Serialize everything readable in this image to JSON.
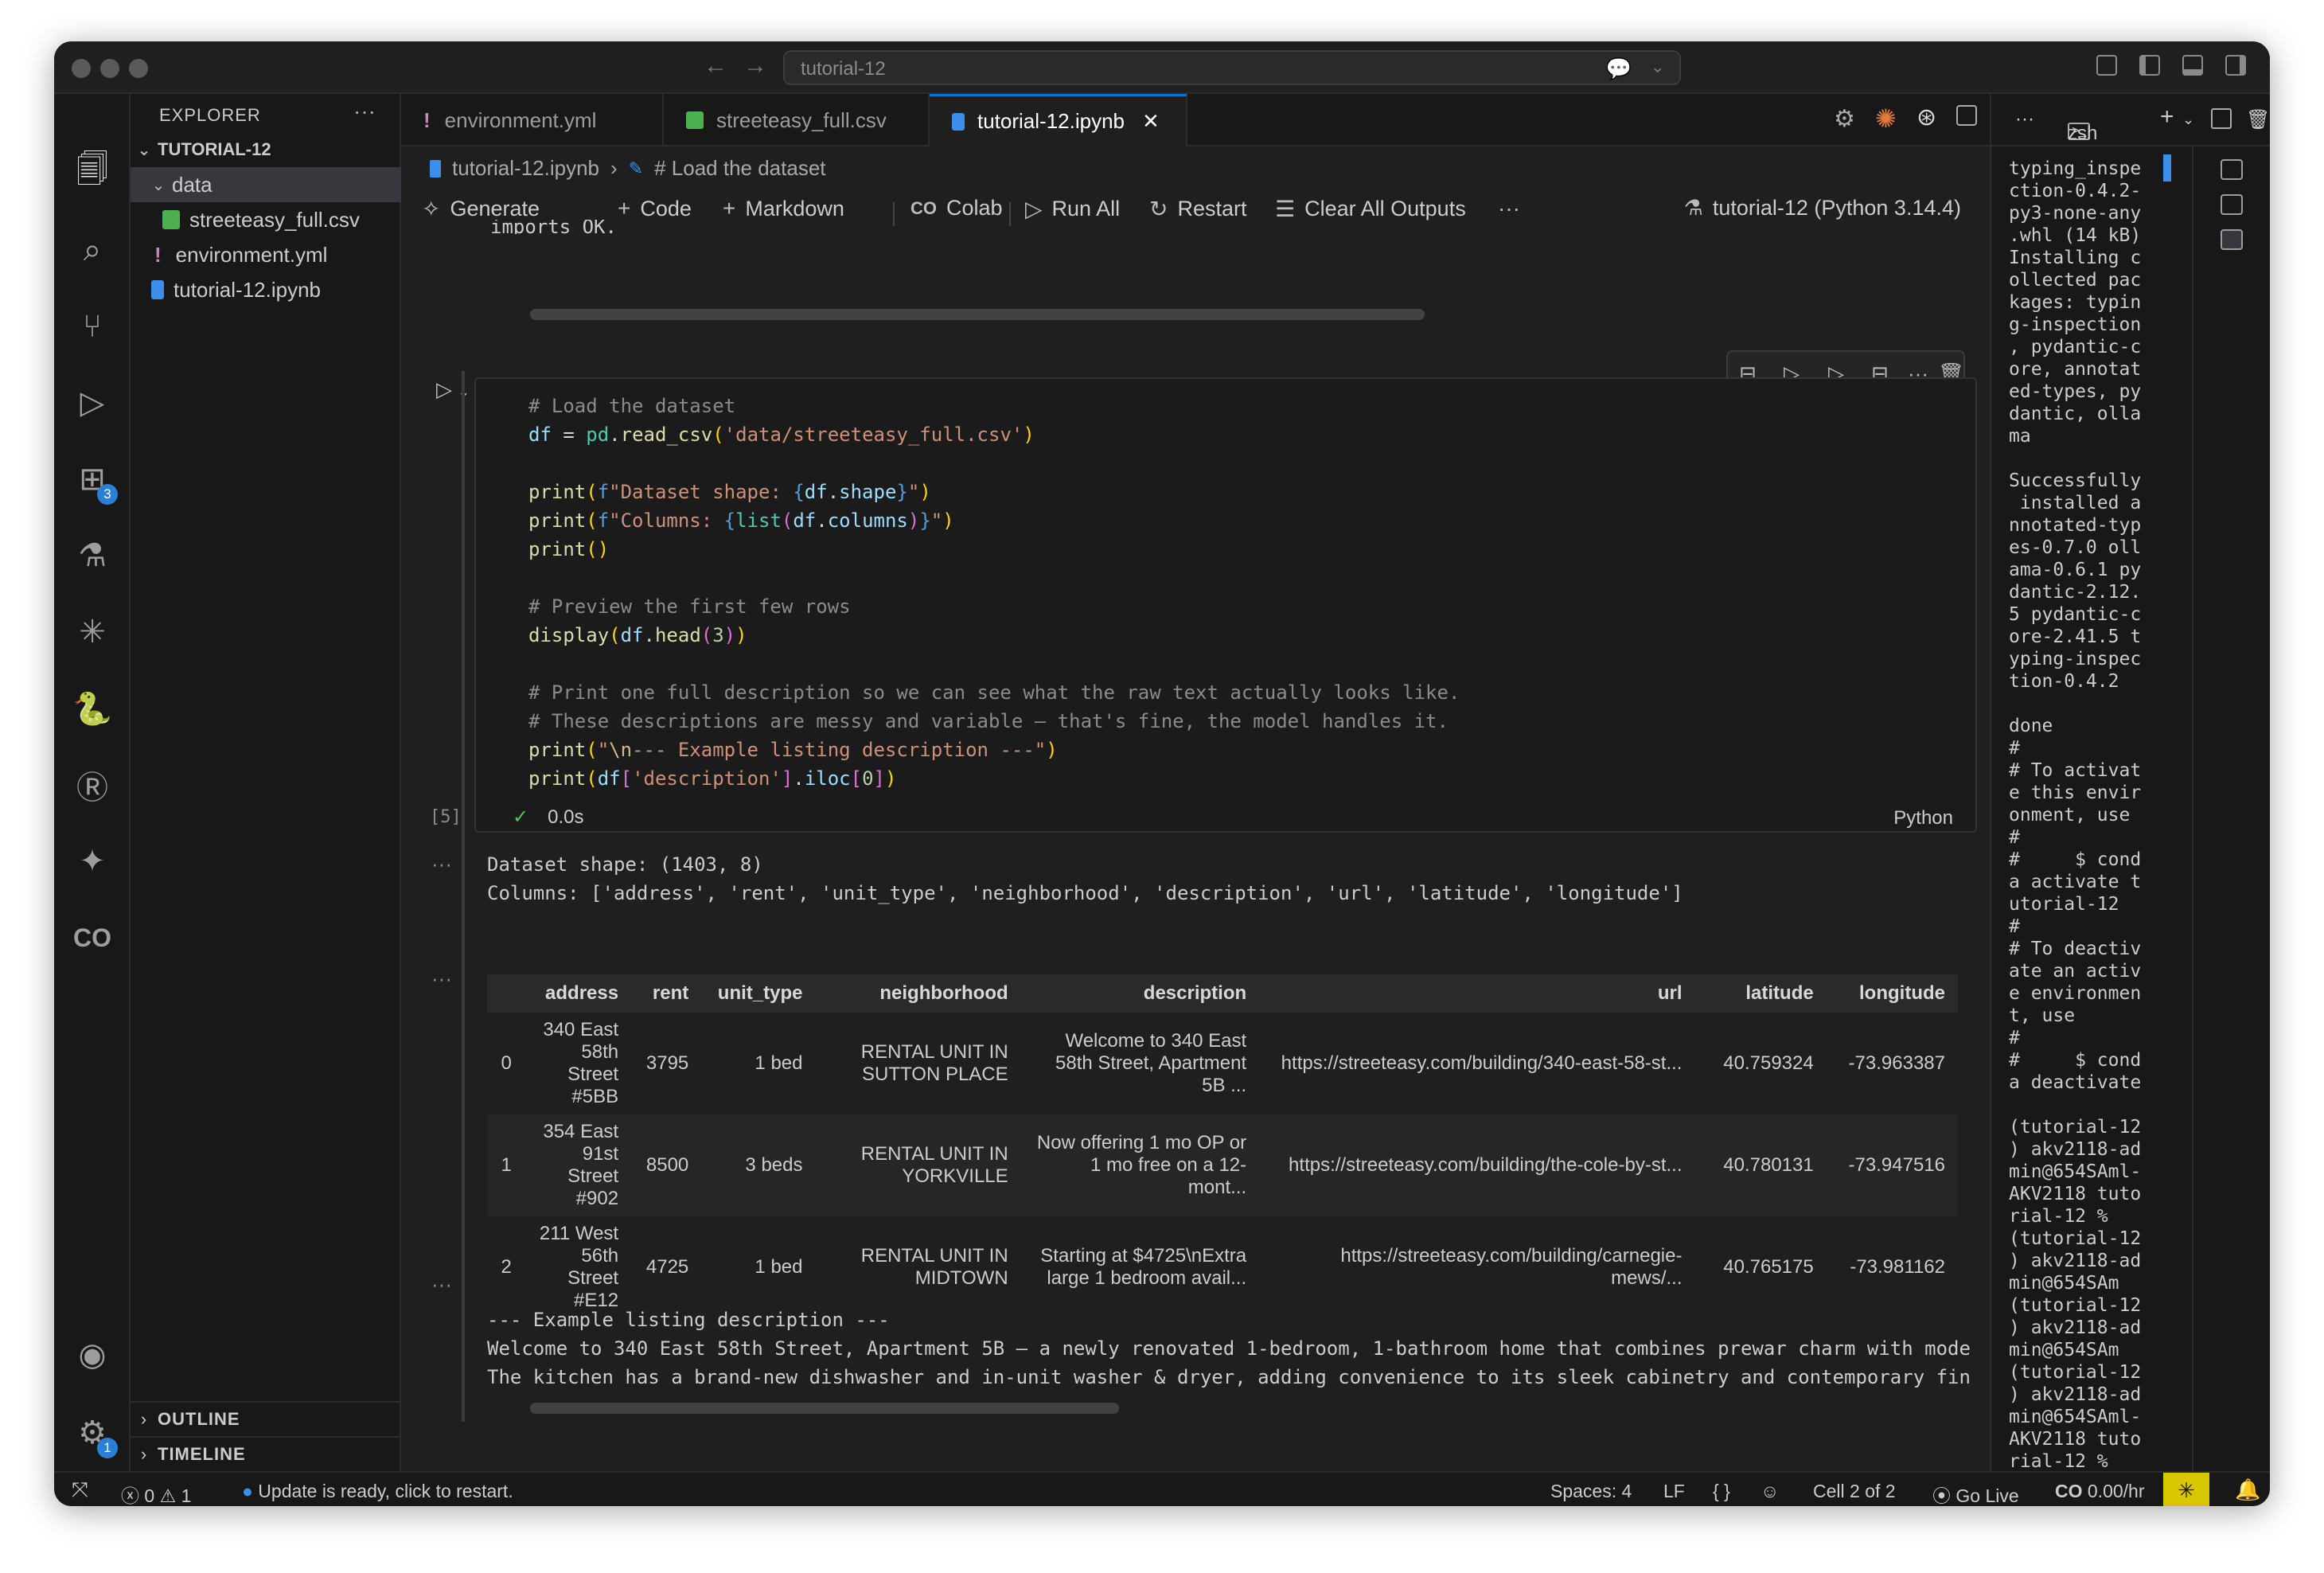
{
  "window": {
    "title": "tutorial-12"
  },
  "explorer": {
    "title": "EXPLORER",
    "project": "TUTORIAL-12",
    "tree": [
      {
        "label": "data"
      },
      {
        "label": "streeteasy_full.csv"
      },
      {
        "label": "environment.yml"
      },
      {
        "label": "tutorial-12.ipynb"
      }
    ],
    "outline": "OUTLINE",
    "timeline": "TIMELINE"
  },
  "activity": {
    "extensions_badge": "3",
    "settings_badge": "1"
  },
  "tabs": [
    {
      "label": "environment.yml"
    },
    {
      "label": "streeteasy_full.csv"
    },
    {
      "label": "tutorial-12.ipynb"
    }
  ],
  "breadcrumb": {
    "file": "tutorial-12.ipynb",
    "section": "# Load the dataset"
  },
  "toolbar": {
    "generate": "Generate",
    "code": "Code",
    "markdown": "Markdown",
    "colab": "Colab",
    "run_all": "Run All",
    "restart": "Restart",
    "clear_outputs": "Clear All Outputs",
    "kernel": "tutorial-12 (Python 3.14.4)"
  },
  "prev_output": "imports OK.",
  "cell": {
    "exec_count": "[5]",
    "time": "0.0s",
    "language": "Python"
  },
  "output": {
    "shape_line": "Dataset shape: (1403, 8)",
    "columns_line": "Columns: ['address', 'rent', 'unit_type', 'neighborhood', 'description', 'url', 'latitude', 'longitude']",
    "example_header": "--- Example listing description ---",
    "example_line1": "Welcome to 340 East 58th Street, Apartment 5B — a newly renovated 1-bedroom, 1-bathroom home that combines prewar charm with moder",
    "example_line2": "The kitchen has a brand-new dishwasher and in-unit washer & dryer, adding convenience to its sleek cabinetry and contemporary fin:"
  },
  "table": {
    "headers": [
      "",
      "address",
      "rent",
      "unit_type",
      "neighborhood",
      "description",
      "url",
      "latitude",
      "longitude"
    ],
    "rows": [
      {
        "idx": "0",
        "address": "340 East 58th Street #5BB",
        "rent": "3795",
        "unit_type": "1 bed",
        "neighborhood": "RENTAL UNIT IN SUTTON PLACE",
        "description": "Welcome to 340 East 58th Street, Apartment 5B ...",
        "url": "https://streeteasy.com/building/340-east-58-st...",
        "latitude": "40.759324",
        "longitude": "-73.963387"
      },
      {
        "idx": "1",
        "address": "354 East 91st Street #902",
        "rent": "8500",
        "unit_type": "3 beds",
        "neighborhood": "RENTAL UNIT IN YORKVILLE",
        "description": "Now offering 1 mo OP or 1 mo free on a 12-mont...",
        "url": "https://streeteasy.com/building/the-cole-by-st...",
        "latitude": "40.780131",
        "longitude": "-73.947516"
      },
      {
        "idx": "2",
        "address": "211 West 56th Street #E12",
        "rent": "4725",
        "unit_type": "1 bed",
        "neighborhood": "RENTAL UNIT IN MIDTOWN",
        "description": "Starting at $4725\\nExtra large 1 bedroom avail...",
        "url": "https://streeteasy.com/building/carnegie-mews/...",
        "latitude": "40.765175",
        "longitude": "-73.981162"
      }
    ]
  },
  "terminal": {
    "shell": "zsh",
    "text": "typing_inspe\nction-0.4.2-\npy3-none-any\n.whl (14 kB)\nInstalling c\nollected pac\nkages: typin\ng-inspection\n, pydantic-c\nore, annotat\ned-types, py\ndantic, olla\nma\n\nSuccessfully\n installed a\nnnotated-typ\nes-0.7.0 oll\nama-0.6.1 py\ndantic-2.12.\n5 pydantic-c\nore-2.41.5 t\nyping-inspec\ntion-0.4.2\n\ndone\n#\n# To activat\ne this envir\nonment, use\n#\n#     $ cond\na activate t\nutorial-12\n#\n# To deactiv\nate an activ\ne environmen\nt, use\n#\n#     $ cond\na deactivate\n\n(tutorial-12\n) akv2118-ad\nmin@654SAml-\nAKV2118 tuto\nrial-12 %\n(tutorial-12\n) akv2118-ad\nmin@654SAm\n(tutorial-12\n) akv2118-ad\nmin@654SAm\n(tutorial-12\n) akv2118-ad\nmin@654SAml-\nAKV2118 tuto\nrial-12 % "
  },
  "statusbar": {
    "errors": "0",
    "warnings": "1",
    "update": "Update is ready, click to restart.",
    "spaces": "Spaces: 4",
    "eol": "LF",
    "braces": "{ }",
    "cell": "Cell 2 of 2",
    "golive": "Go Live",
    "cost": "0.00/hr"
  }
}
